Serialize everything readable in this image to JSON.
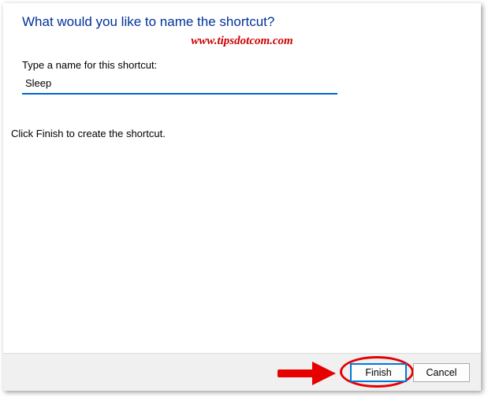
{
  "dialog": {
    "heading": "What would you like to name the shortcut?",
    "watermark": "www.tipsdotcom.com",
    "field_label": "Type a name for this shortcut:",
    "input_value": "Sleep",
    "instruction": "Click Finish to create the shortcut.",
    "buttons": {
      "finish": "Finish",
      "cancel": "Cancel"
    }
  }
}
